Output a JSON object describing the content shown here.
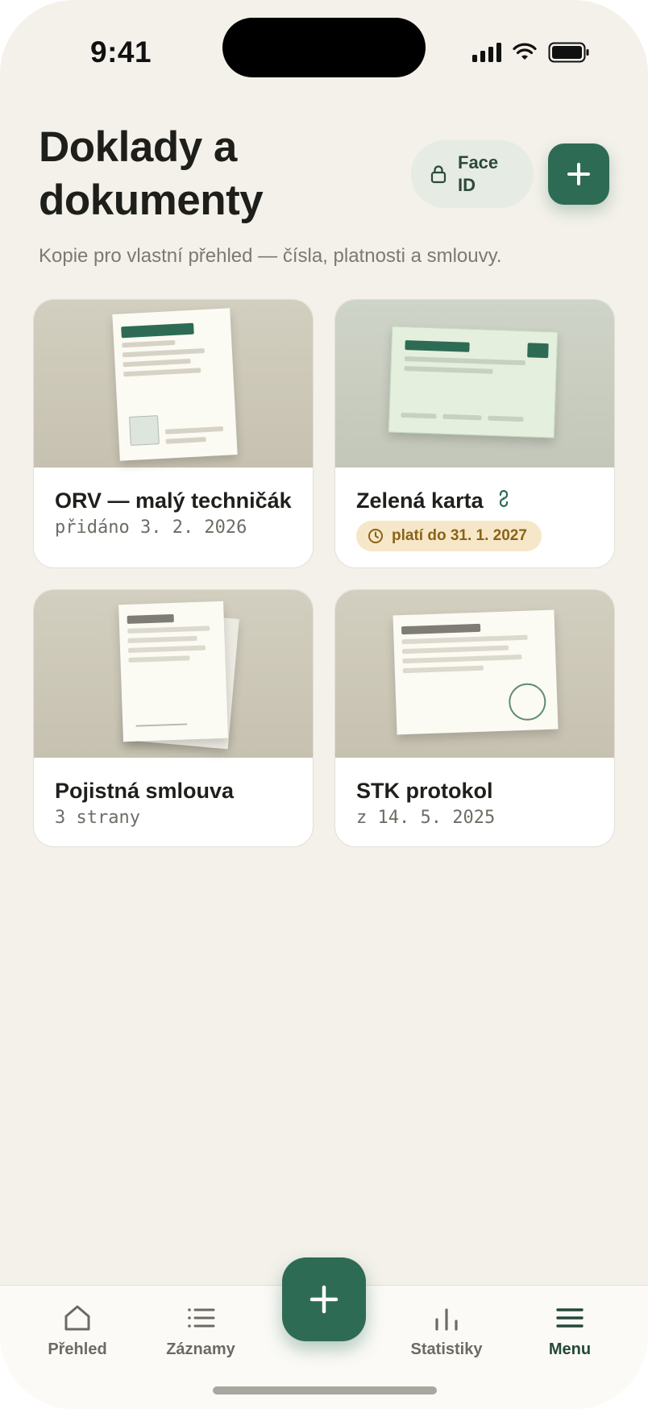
{
  "status_bar": {
    "time": "9:41"
  },
  "header": {
    "title_line1": "Doklady a",
    "title_line2": "dokumenty",
    "face_id_line1": "Face",
    "face_id_line2": "ID",
    "subtitle": "Kopie pro vlastní přehled — čísla, platnosti a smlouvy."
  },
  "documents": [
    {
      "title": "ORV — malý techničák",
      "subtitle": "přidáno 3. 2. 2026",
      "icon": "document-icon"
    },
    {
      "title": "Zelená karta",
      "badge": "platí do 31. 1. 2027",
      "icon": "link-icon",
      "badge_icon": "clock-icon"
    },
    {
      "title": "Pojistná smlouva",
      "subtitle": "3 strany"
    },
    {
      "title": "STK protokol",
      "subtitle": "z 14. 5. 2025"
    }
  ],
  "tabbar": {
    "items": [
      {
        "label": "Přehled",
        "icon": "home-icon"
      },
      {
        "label": "Záznamy",
        "icon": "list-icon"
      },
      {
        "label": "Statistiky",
        "icon": "chart-icon"
      },
      {
        "label": "Menu",
        "icon": "menu-icon",
        "active": true
      }
    ]
  },
  "colors": {
    "accent": "#2e6b55",
    "background": "#f3f1ea",
    "badge_bg": "#f6e7c8",
    "badge_text": "#8a6318"
  }
}
